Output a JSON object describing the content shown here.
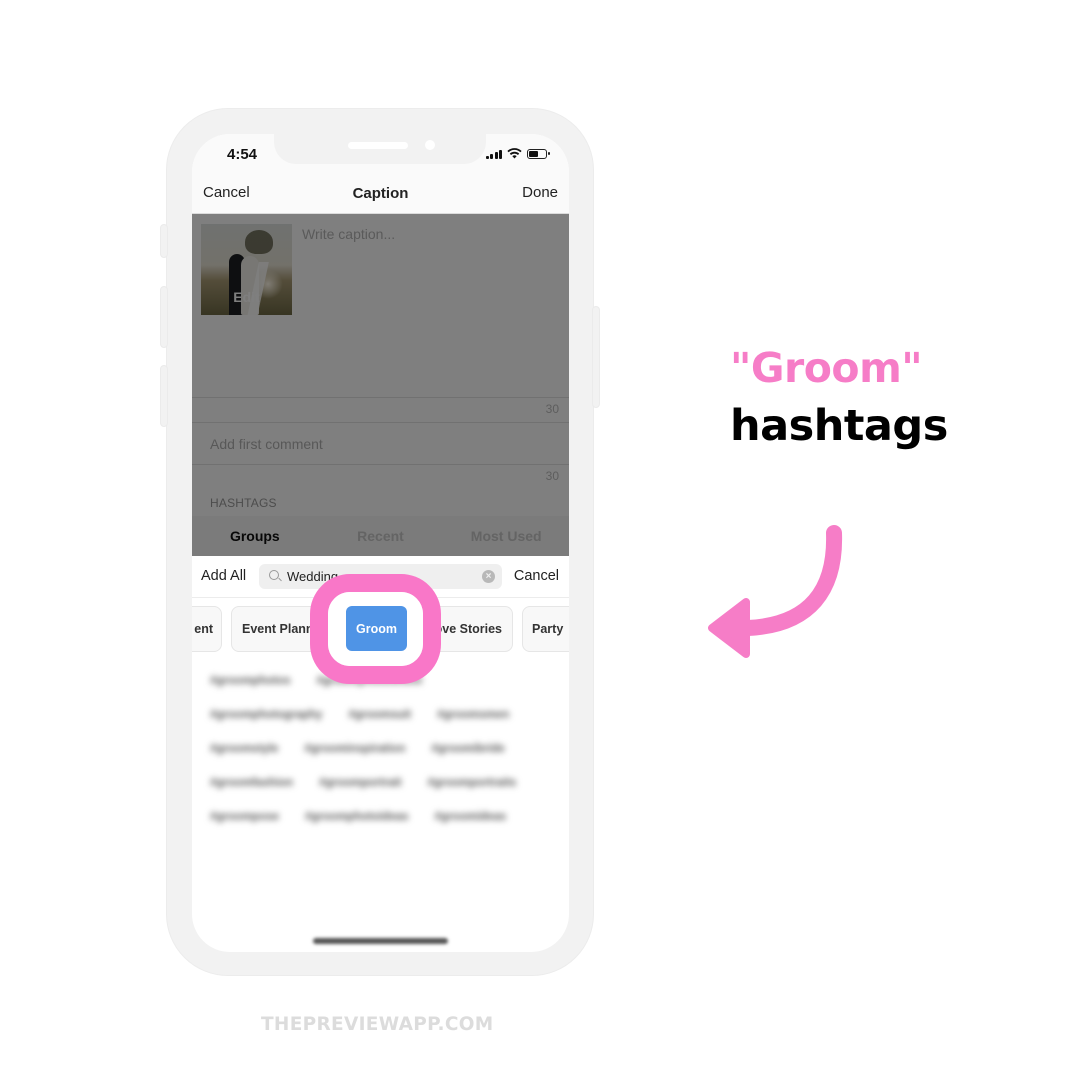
{
  "status_bar": {
    "time": "4:54",
    "battery_level": 0.55
  },
  "nav": {
    "cancel_label": "Cancel",
    "title": "Caption",
    "done_label": "Done"
  },
  "post": {
    "thumbnail_edit_label": "Edit",
    "caption_placeholder": "Write caption...",
    "caption_remaining": "30",
    "first_comment_placeholder": "Add first comment",
    "comment_remaining": "30",
    "hashtags_section_label": "HASHTAGS"
  },
  "segments": [
    {
      "label": "Groups",
      "active": true
    },
    {
      "label": "Recent",
      "active": false
    },
    {
      "label": "Most Used",
      "active": false
    }
  ],
  "search_row": {
    "add_all_label": "Add All",
    "search_value": "Wedding",
    "cancel_label": "Cancel"
  },
  "groups": [
    {
      "label": "ent",
      "selected": false
    },
    {
      "label": "Event Planner",
      "selected": false
    },
    {
      "label": "Groom",
      "selected": true
    },
    {
      "label": "Love Stories",
      "selected": false
    },
    {
      "label": "Party",
      "selected": false
    }
  ],
  "hashtag_rows": [
    [
      "#groomphotos",
      "#groomphotoshoot"
    ],
    [
      "#groomphotography",
      "#groomsuit",
      "#groomsmen"
    ],
    [
      "#groomstyle",
      "#groominspiration",
      "#groomibride"
    ],
    [
      "#groomfashion",
      "#groomportrait",
      "#groomportraits"
    ],
    [
      "#groompose",
      "#groomphotoideas",
      "#groomideas"
    ]
  ],
  "annotation": {
    "headline_highlight": "\"Groom\"",
    "headline_rest": "hashtags",
    "accent_color": "#f67dc7",
    "selected_chip_color": "#4f94e6"
  },
  "footer": {
    "brand": "THEPREVIEWAPP.COM"
  }
}
